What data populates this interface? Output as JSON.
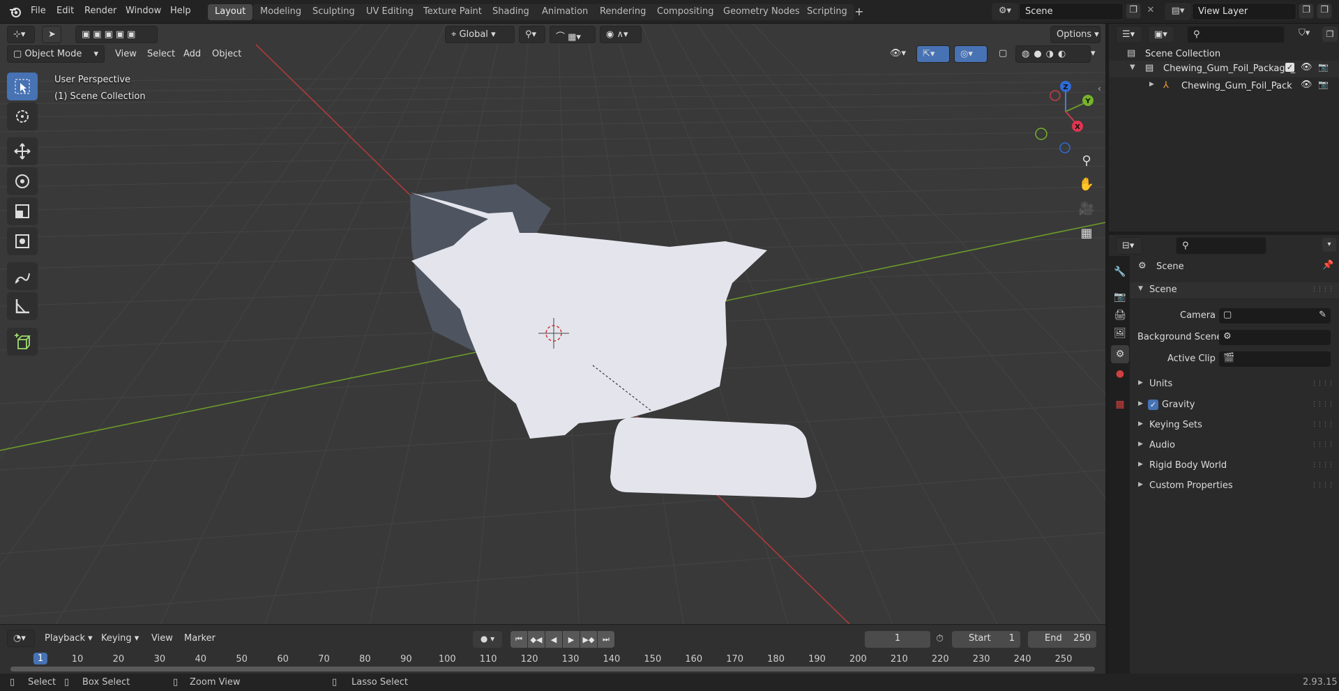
{
  "top_menu": [
    "File",
    "Edit",
    "Render",
    "Window",
    "Help"
  ],
  "workspaces": [
    "Layout",
    "Modeling",
    "Sculpting",
    "UV Editing",
    "Texture Paint",
    "Shading",
    "Animation",
    "Rendering",
    "Compositing",
    "Geometry Nodes",
    "Scripting"
  ],
  "active_workspace": "Layout",
  "scene_name": "Scene",
  "view_layer": "View Layer",
  "viewport": {
    "mode": "Object Mode",
    "menus": [
      "View",
      "Select",
      "Add",
      "Object"
    ],
    "transform_orientation": "Global",
    "options_label": "Options",
    "perspective_text": "User Perspective",
    "collection_text": "(1) Scene Collection",
    "gizmo": {
      "x": "X",
      "y": "Y",
      "z": "Z"
    }
  },
  "timeline": {
    "menus": [
      "Playback",
      "Keying",
      "View",
      "Marker"
    ],
    "current_frame": "1",
    "start_label": "Start",
    "start_value": "1",
    "end_label": "End",
    "end_value": "250",
    "frame_numbers": [
      "1",
      "10",
      "20",
      "30",
      "40",
      "50",
      "60",
      "70",
      "80",
      "90",
      "100",
      "110",
      "120",
      "130",
      "140",
      "150",
      "160",
      "170",
      "180",
      "190",
      "200",
      "210",
      "220",
      "230",
      "240",
      "250"
    ]
  },
  "statusbar": {
    "select": "Select",
    "box_select": "Box Select",
    "zoom_view": "Zoom View",
    "lasso_select": "Lasso Select",
    "version": "2.93.15"
  },
  "outliner": {
    "root": "Scene Collection",
    "collection": "Chewing_Gum_Foil_Package_",
    "object": "Chewing_Gum_Foil_Pack"
  },
  "properties": {
    "context_title": "Scene",
    "section": "Scene",
    "camera_label": "Camera",
    "background_scene_label": "Background Scene",
    "active_clip_label": "Active Clip",
    "panels": [
      "Units",
      "Gravity",
      "Keying Sets",
      "Audio",
      "Rigid Body World",
      "Custom Properties"
    ],
    "gravity_checked": true
  },
  "colors": {
    "accent": "#4772b3",
    "x_axis": "#b03a3a",
    "y_axis": "#6c9a2a",
    "mesh": "#e4e5ec"
  }
}
